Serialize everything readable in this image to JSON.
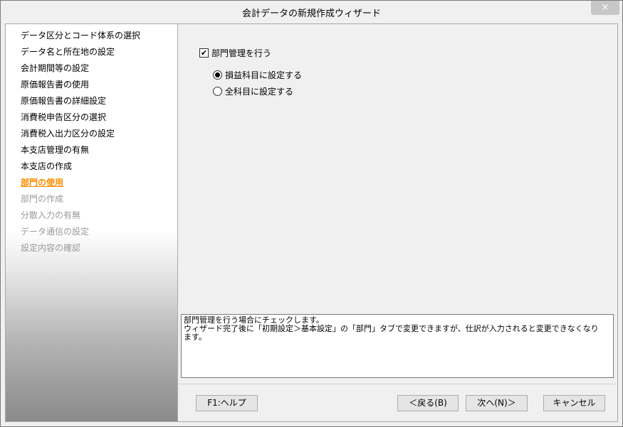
{
  "window": {
    "title": "会計データの新規作成ウィザード",
    "close_glyph": "×"
  },
  "sidebar": {
    "items": [
      {
        "label": "データ区分とコード体系の選択",
        "state": "done"
      },
      {
        "label": "データ名と所在地の設定",
        "state": "done"
      },
      {
        "label": "会計期間等の設定",
        "state": "done"
      },
      {
        "label": "原価報告書の使用",
        "state": "done"
      },
      {
        "label": "原価報告書の詳細設定",
        "state": "done"
      },
      {
        "label": "消費税申告区分の選択",
        "state": "done"
      },
      {
        "label": "消費税入出力区分の設定",
        "state": "done"
      },
      {
        "label": "本支店管理の有無",
        "state": "done"
      },
      {
        "label": "本支店の作成",
        "state": "done"
      },
      {
        "label": "部門の使用",
        "state": "current"
      },
      {
        "label": "部門の作成",
        "state": "pending"
      },
      {
        "label": "分散入力の有無",
        "state": "pending"
      },
      {
        "label": "データ通信の設定",
        "state": "pending"
      },
      {
        "label": "設定内容の確認",
        "state": "pending"
      }
    ],
    "current_color": "#ff8c00",
    "pending_color": "#9a9a9a"
  },
  "main": {
    "checkbox": {
      "label": "部門管理を行う",
      "checked": true,
      "mark": "✔"
    },
    "radios": [
      {
        "label": "損益科目に設定する",
        "selected": true
      },
      {
        "label": "全科目に設定する",
        "selected": false
      }
    ],
    "description": {
      "lines": [
        "部門管理を行う場合にチェックします。",
        "ウィザード完了後に「初期設定＞基本設定」の「部門」タブで変更できますが、仕訳が入力されると変更できなくなり",
        "ます。"
      ]
    }
  },
  "footer": {
    "help_label": "F1:ヘルプ",
    "back_label": "＜戻る(B)",
    "next_label": "次へ(N)＞",
    "cancel_label": "キャンセル"
  }
}
